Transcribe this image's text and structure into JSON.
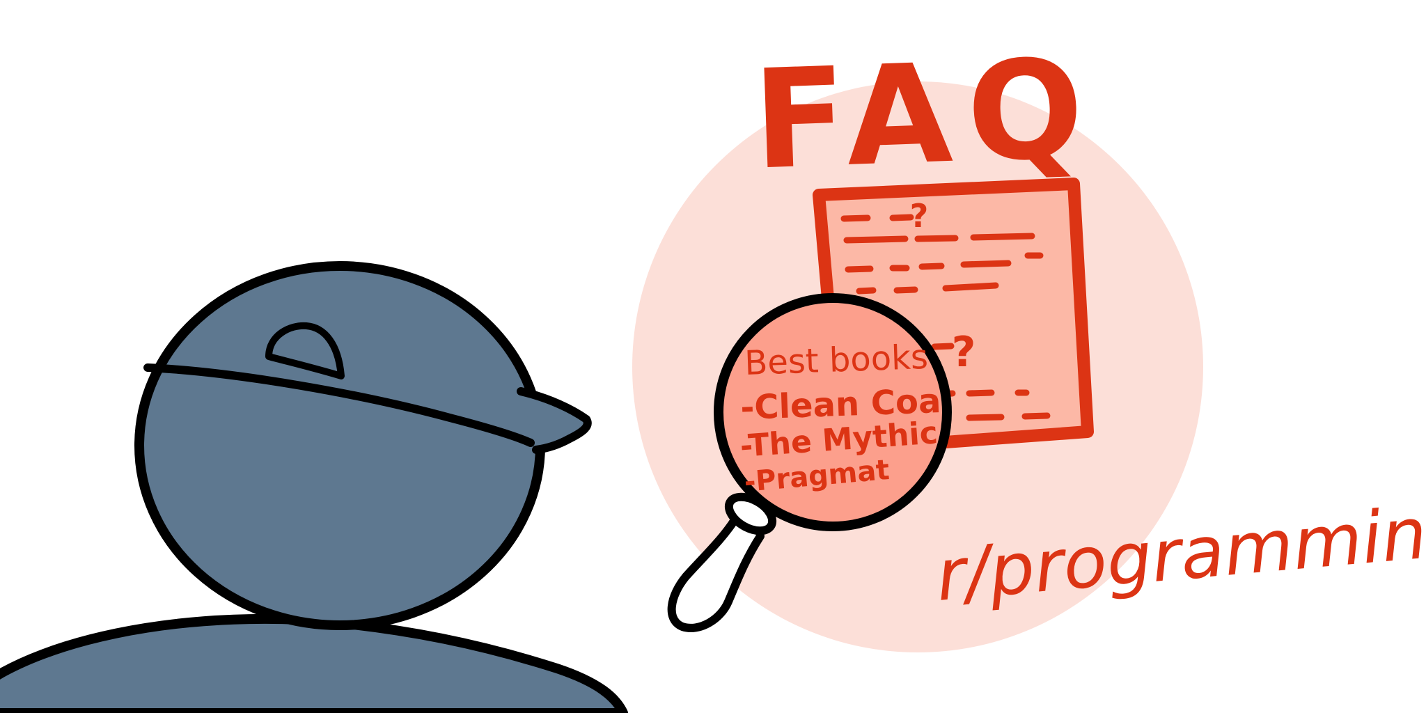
{
  "title": "FAQ",
  "magnifier": {
    "heading": "Best books",
    "items": [
      "-Clean Coa",
      "-The Mythic",
      "-Pragmat"
    ]
  },
  "document": {
    "marks": [
      "?",
      "?"
    ]
  },
  "subreddit": "r/programming",
  "colors": {
    "accent": "#dc3414",
    "bubble": "#fcdfd8",
    "paper": "#fcb8a6",
    "person": "#5e7890",
    "ink": "#000000"
  }
}
